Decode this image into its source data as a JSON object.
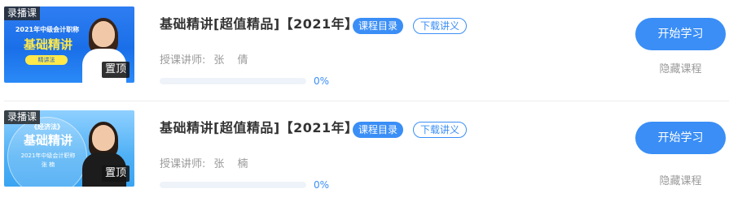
{
  "courses": [
    {
      "thumb": {
        "record_tag": "录播课",
        "pin_tag": "置顶",
        "poster_top": "2021年中级会计职称",
        "poster_title": "基础精讲",
        "poster_sub": "精讲法",
        "poster_name": ""
      },
      "title": "基础精讲[超值精品]【2021年】",
      "catalog_label": "课程目录",
      "handout_label": "下载讲义",
      "teacher_label": "授课讲师:",
      "teacher_name": "张 倩",
      "progress": 0,
      "progress_text": "0%",
      "study_label": "开始学习",
      "hide_label": "隐藏课程"
    },
    {
      "thumb": {
        "record_tag": "录播课",
        "pin_tag": "置顶",
        "poster_top": "《经济法》",
        "poster_title": "基础精讲",
        "poster_sub": "2021年中级会计职称",
        "poster_name": "张 楠"
      },
      "title": "基础精讲[超值精品]【2021年】",
      "catalog_label": "课程目录",
      "handout_label": "下载讲义",
      "teacher_label": "授课讲师:",
      "teacher_name": "张 楠",
      "progress": 0,
      "progress_text": "0%",
      "study_label": "开始学习",
      "hide_label": "隐藏课程"
    }
  ],
  "colors": {
    "accent": "#3a8ef6",
    "muted_text": "#999999",
    "title_text": "#333333"
  }
}
